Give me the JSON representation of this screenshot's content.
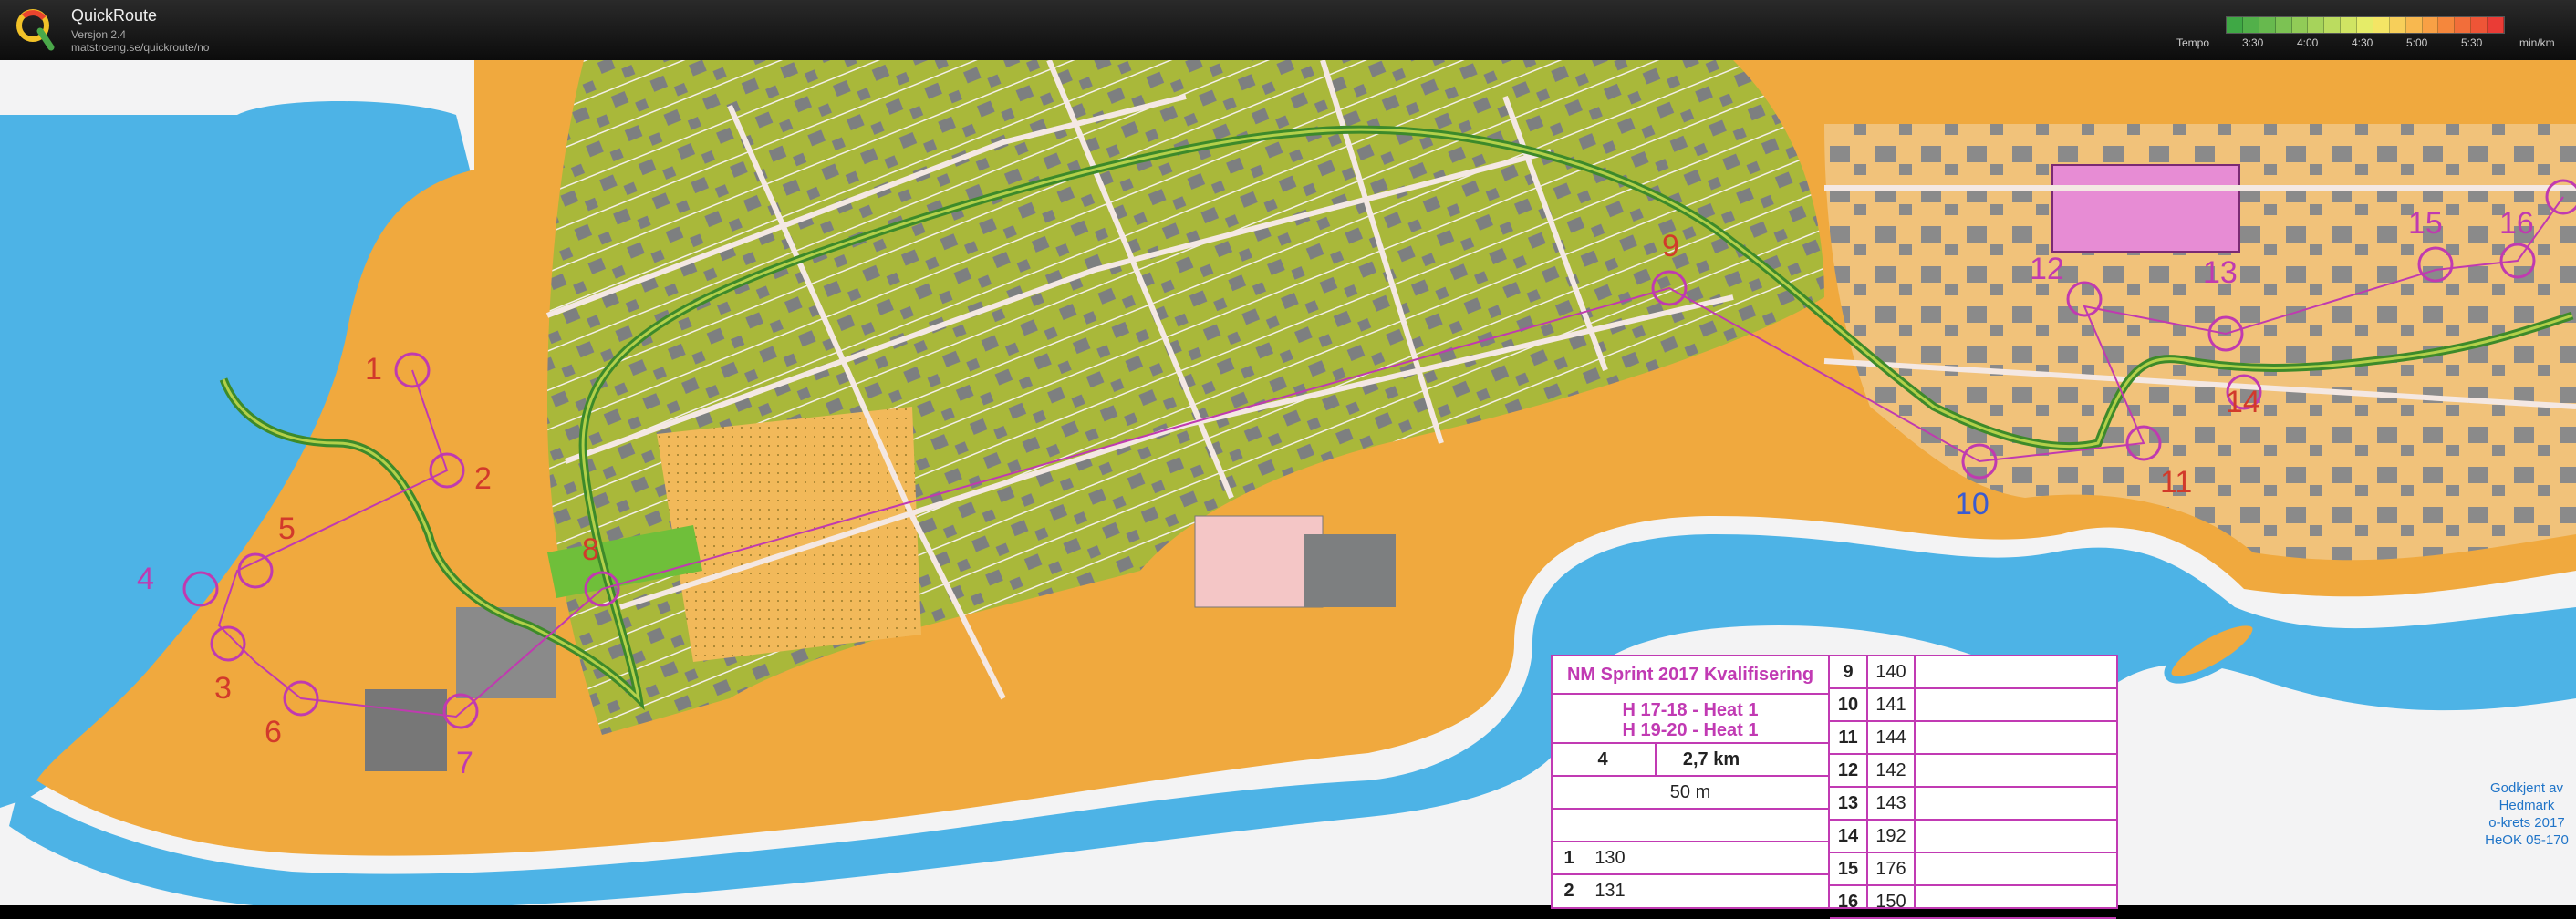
{
  "app": {
    "title": "QuickRoute",
    "version": "Versjon 2.4",
    "url": "matstroeng.se/quickroute/no"
  },
  "legend": {
    "label": "Tempo",
    "ticks": [
      "3:30",
      "4:00",
      "4:30",
      "5:00",
      "5:30"
    ],
    "unit": "min/km",
    "colors": [
      "#3fa845",
      "#52b04a",
      "#67b94e",
      "#7cc253",
      "#91cb57",
      "#a6d35b",
      "#bbdc5f",
      "#d0e463",
      "#e5ec68",
      "#f4e565",
      "#f7cf5a",
      "#f8b84f",
      "#f8a045",
      "#f5873c",
      "#f26e3a",
      "#ee5537",
      "#ea3c36"
    ]
  },
  "course": {
    "title": "NM Sprint 2017 Kvalifisering",
    "class1": "H 17-18 - Heat 1",
    "class2": "H 19-20 - Heat 1",
    "course_no": "4",
    "length": "2,7 km",
    "climb": "50 m",
    "controls": [
      {
        "n": "1",
        "code": "130"
      },
      {
        "n": "2",
        "code": "131"
      },
      {
        "n": "9",
        "code": "140"
      },
      {
        "n": "10",
        "code": "141"
      },
      {
        "n": "11",
        "code": "144"
      },
      {
        "n": "12",
        "code": "142"
      },
      {
        "n": "13",
        "code": "143"
      },
      {
        "n": "14",
        "code": "192"
      },
      {
        "n": "15",
        "code": "176"
      },
      {
        "n": "16",
        "code": "150"
      }
    ]
  },
  "map_labels": [
    "1",
    "2",
    "3",
    "4",
    "5",
    "6",
    "7",
    "8",
    "9",
    "10",
    "11",
    "12",
    "13",
    "14",
    "15",
    "16"
  ],
  "approval": {
    "line1": "Godkjent av",
    "line2": "Hedmark",
    "line3": "o-krets 2017",
    "line4": "HeOK 05-170"
  }
}
